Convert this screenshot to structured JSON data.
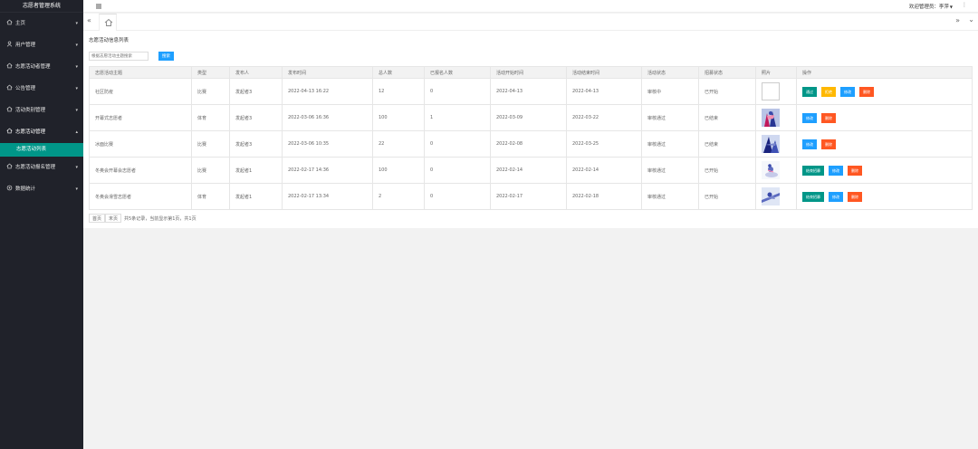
{
  "app": {
    "title": "志愿者管理系统"
  },
  "header": {
    "welcome": "欢迎管理员：李萍",
    "more_icon": "vertical-dots-icon"
  },
  "sidebar": {
    "items": [
      {
        "label": "主页",
        "arrow": "▾"
      },
      {
        "label": "用户管理",
        "arrow": "▾"
      },
      {
        "label": "志愿活动者管理",
        "arrow": "▾"
      },
      {
        "label": "公告管理",
        "arrow": "▾"
      },
      {
        "label": "活动类别管理",
        "arrow": "▾"
      },
      {
        "label": "志愿活动管理",
        "arrow": "▴"
      },
      {
        "label": "志愿活动列表"
      },
      {
        "label": "志愿活动报名管理",
        "arrow": "▾"
      },
      {
        "label": "数据统计",
        "arrow": "▾"
      }
    ]
  },
  "main": {
    "title": "志愿活动信息列表",
    "search": {
      "placeholder": "根据志愿活动主题搜索",
      "button": "搜索"
    },
    "columns": [
      "志愿活动主题",
      "类型",
      "发布人",
      "发布时间",
      "总人数",
      "已报名人数",
      "活动开始时间",
      "活动结束时间",
      "活动状态",
      "招募状态",
      "照片",
      "操作"
    ],
    "rows": [
      {
        "topic": "社区防疫",
        "type": "比赛",
        "publisher": "发起者3",
        "pub_time": "2022-04-13 16:22",
        "total": "12",
        "signed": "0",
        "start": "2022-04-13",
        "end": "2022-04-13",
        "status": "审核中",
        "recruit": "已开始",
        "photo": "empty",
        "actions": [
          "通过",
          "拒绝",
          "修改",
          "删除"
        ]
      },
      {
        "topic": "开幕式志愿者",
        "type": "体育",
        "publisher": "发起者3",
        "pub_time": "2022-03-06 16:36",
        "total": "100",
        "signed": "1",
        "start": "2022-03-09",
        "end": "2022-03-22",
        "status": "审核通过",
        "recruit": "已结束",
        "photo": "p1",
        "actions": [
          "修改",
          "删除"
        ]
      },
      {
        "topic": "冰面比赛",
        "type": "比赛",
        "publisher": "发起者3",
        "pub_time": "2022-03-06 10:35",
        "total": "22",
        "signed": "0",
        "start": "2022-02-08",
        "end": "2022-03-25",
        "status": "审核通过",
        "recruit": "已结束",
        "photo": "p2",
        "actions": [
          "修改",
          "删除"
        ]
      },
      {
        "topic": "冬奥会开幕会志愿者",
        "type": "比赛",
        "publisher": "发起者1",
        "pub_time": "2022-02-17 14:36",
        "total": "100",
        "signed": "0",
        "start": "2022-02-14",
        "end": "2022-02-14",
        "status": "审核通过",
        "recruit": "已开始",
        "photo": "p3",
        "actions": [
          "结束招募",
          "修改",
          "删除"
        ]
      },
      {
        "topic": "冬奥会滑雪志愿者",
        "type": "体育",
        "publisher": "发起者1",
        "pub_time": "2022-02-17 13:34",
        "total": "2",
        "signed": "0",
        "start": "2022-02-17",
        "end": "2022-02-18",
        "status": "审核通过",
        "recruit": "已开始",
        "photo": "p4",
        "actions": [
          "结束招募",
          "修改",
          "删除"
        ]
      }
    ],
    "pager": {
      "first": "首页",
      "last": "末页",
      "info": "共5条记录，当前显示第1页，共1页"
    }
  },
  "colors": {
    "sidebar": "#20222a",
    "active": "#009688",
    "blue": "#1e9fff",
    "yellow": "#ffb800",
    "red": "#ff5722"
  }
}
